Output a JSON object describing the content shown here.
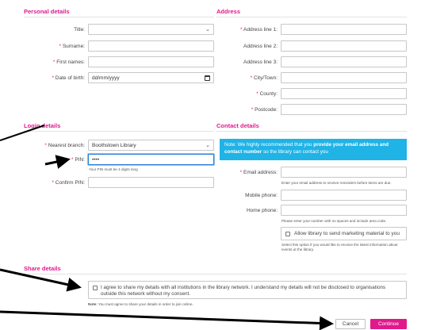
{
  "sections": {
    "personal": "Personal details",
    "address": "Address",
    "login": "Login details",
    "contact": "Contact details",
    "share": "Share details"
  },
  "personal": {
    "title_label": "Title:",
    "surname_label": "Surname:",
    "firstnames_label": "First names:",
    "dob_label": "Date of birth:",
    "dob_placeholder": "dd/mm/yyyy"
  },
  "address": {
    "line1_label": "Address line 1:",
    "line2_label": "Address line 2:",
    "line3_label": "Address line 3:",
    "city_label": "City/Town:",
    "county_label": "County:",
    "postcode_label": "Postcode:"
  },
  "login": {
    "branch_label": "Nearest branch:",
    "branch_value": "Boothstown Library",
    "pin_label": "PIN:",
    "pin_value": "••••",
    "pin_hint": "Your PIN must be 4 digits long",
    "confirm_label": "Confirm PIN:"
  },
  "contact": {
    "notice_pre": "Note: We highly recommended that you ",
    "notice_bold": "provide your email address and contact number",
    "notice_post": " so the library can contact you",
    "email_label": "Email address:",
    "email_hint": "Enter your email address to receive reminders before items are due.",
    "mobile_label": "Mobile phone:",
    "home_label": "Home phone:",
    "phone_hint": "Please enter your number with no spaces and include area code.",
    "marketing_label": "Allow library to send marketing material to you",
    "marketing_hint": "Select this option if you would like to receive the latest information about events at the library."
  },
  "share": {
    "agree_text": "I agree to share my details with all institutions in the library network. I understand my details will not be disclosed to organisations outside this network without my consent.",
    "note_bold": "Note:",
    "note_text": " You must agree to share your details in order to join online."
  },
  "buttons": {
    "cancel": "Cancel",
    "continue": "Continue"
  },
  "required_mark": "*",
  "colors": {
    "accent": "#e0198c",
    "notice": "#1fb3e6",
    "focus": "#2a7fd4"
  }
}
